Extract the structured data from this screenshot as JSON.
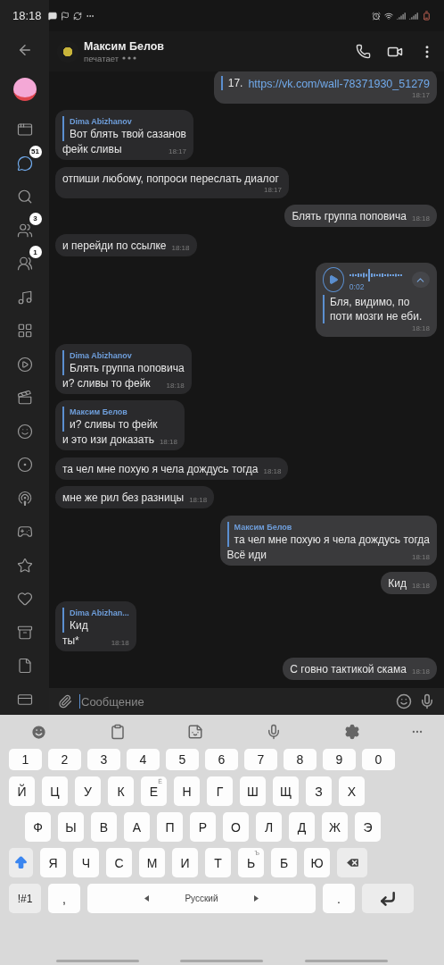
{
  "status_bar": {
    "time": "18:18"
  },
  "sidebar": {
    "items": [
      {
        "selected": false
      },
      {
        "selected": true,
        "badge": "51"
      },
      {
        "selected": false
      },
      {
        "selected": false,
        "badge": "3"
      },
      {
        "selected": false,
        "badge": "1"
      },
      {
        "selected": false
      },
      {
        "selected": false
      },
      {
        "selected": false
      },
      {
        "selected": false
      },
      {
        "selected": false
      },
      {
        "selected": false
      },
      {
        "selected": false
      },
      {
        "selected": false
      },
      {
        "selected": false
      },
      {
        "selected": false
      },
      {
        "selected": false
      },
      {
        "selected": false
      },
      {
        "selected": false
      }
    ]
  },
  "header": {
    "name": "Максим Белов",
    "status": "печатает"
  },
  "messages": [
    {
      "kind": "link",
      "outgoing": true,
      "text": "17.",
      "link": "https://vk.com/wall-78371930_51279",
      "time": "18:17"
    },
    {
      "kind": "reply",
      "outgoing": false,
      "reply": {
        "author": "Dima Abizhanov",
        "text": "Вот блять твой сазанов"
      },
      "text": "фейк сливы",
      "time": "18:17"
    },
    {
      "kind": "text",
      "outgoing": false,
      "text": "отпиши любому, попроси переслать диалог",
      "time": "18:17"
    },
    {
      "kind": "text",
      "outgoing": true,
      "text": "Блять группа поповича",
      "time": "18:18"
    },
    {
      "kind": "text",
      "outgoing": false,
      "text": "и перейди по ссылке",
      "time": "18:18"
    },
    {
      "kind": "voice",
      "outgoing": true,
      "duration": "0:02",
      "transcript": "Бля, видимо, по поти мозги не еби.",
      "time": "18:18"
    },
    {
      "kind": "reply",
      "outgoing": false,
      "reply": {
        "author": "Dima Abizhanov",
        "text": "Блять группа поповича"
      },
      "text": "и? сливы то фейк",
      "time": "18:18"
    },
    {
      "kind": "reply",
      "outgoing": false,
      "reply": {
        "author": "Максим Белов",
        "text": "и? сливы то фейк"
      },
      "text": "и это изи доказать",
      "time": "18:18"
    },
    {
      "kind": "text",
      "outgoing": false,
      "text": "та чел мне похую я чела дождусь тогда",
      "time": "18:18"
    },
    {
      "kind": "text",
      "outgoing": false,
      "text": "мне же рил без разницы",
      "time": "18:18"
    },
    {
      "kind": "reply",
      "outgoing": true,
      "reply": {
        "author": "Максим Белов",
        "text": "та чел мне похую я чела дождусь тогда"
      },
      "text": "Всё иди",
      "time": "18:18"
    },
    {
      "kind": "text",
      "outgoing": true,
      "text": "Кид",
      "time": "18:18"
    },
    {
      "kind": "reply",
      "outgoing": false,
      "reply": {
        "author": "Dima Abizhan...",
        "text": "Кид"
      },
      "text": "ты*",
      "time": "18:18"
    },
    {
      "kind": "text",
      "outgoing": true,
      "text": "С говно тактикой скама",
      "time": "18:18"
    }
  ],
  "composer": {
    "placeholder": "Сообщение"
  },
  "keyboard": {
    "rows": [
      [
        {
          "kind": "char",
          "label": "1"
        },
        {
          "kind": "char",
          "label": "2"
        },
        {
          "kind": "char",
          "label": "3"
        },
        {
          "kind": "char",
          "label": "4"
        },
        {
          "kind": "char",
          "label": "5"
        },
        {
          "kind": "char",
          "label": "6"
        },
        {
          "kind": "char",
          "label": "7"
        },
        {
          "kind": "char",
          "label": "8"
        },
        {
          "kind": "char",
          "label": "9"
        },
        {
          "kind": "char",
          "label": "0"
        }
      ],
      [
        {
          "kind": "char",
          "label": "Й"
        },
        {
          "kind": "char",
          "label": "Ц"
        },
        {
          "kind": "char",
          "label": "У"
        },
        {
          "kind": "char",
          "label": "К"
        },
        {
          "kind": "char",
          "label": "Е",
          "hint": "Ё"
        },
        {
          "kind": "char",
          "label": "Н"
        },
        {
          "kind": "char",
          "label": "Г"
        },
        {
          "kind": "char",
          "label": "Ш"
        },
        {
          "kind": "char",
          "label": "Щ"
        },
        {
          "kind": "char",
          "label": "З"
        },
        {
          "kind": "char",
          "label": "Х"
        }
      ],
      [
        {
          "kind": "char",
          "label": "Ф"
        },
        {
          "kind": "char",
          "label": "Ы"
        },
        {
          "kind": "char",
          "label": "В"
        },
        {
          "kind": "char",
          "label": "А"
        },
        {
          "kind": "char",
          "label": "П"
        },
        {
          "kind": "char",
          "label": "Р"
        },
        {
          "kind": "char",
          "label": "О"
        },
        {
          "kind": "char",
          "label": "Л"
        },
        {
          "kind": "char",
          "label": "Д"
        },
        {
          "kind": "char",
          "label": "Ж"
        },
        {
          "kind": "char",
          "label": "Э"
        }
      ],
      [
        {
          "kind": "shift",
          "on": true
        },
        {
          "kind": "char",
          "label": "Я"
        },
        {
          "kind": "char",
          "label": "Ч"
        },
        {
          "kind": "char",
          "label": "С"
        },
        {
          "kind": "char",
          "label": "М"
        },
        {
          "kind": "char",
          "label": "И"
        },
        {
          "kind": "char",
          "label": "Т"
        },
        {
          "kind": "char",
          "label": "Ь",
          "hint": "Ъ"
        },
        {
          "kind": "char",
          "label": "Б"
        },
        {
          "kind": "char",
          "label": "Ю"
        },
        {
          "kind": "backspace"
        }
      ],
      [
        {
          "kind": "symbols",
          "label": "!#1"
        },
        {
          "kind": "char",
          "label": ","
        },
        {
          "kind": "space",
          "label": "Русский"
        },
        {
          "kind": "char",
          "label": "."
        },
        {
          "kind": "enter"
        }
      ]
    ]
  }
}
